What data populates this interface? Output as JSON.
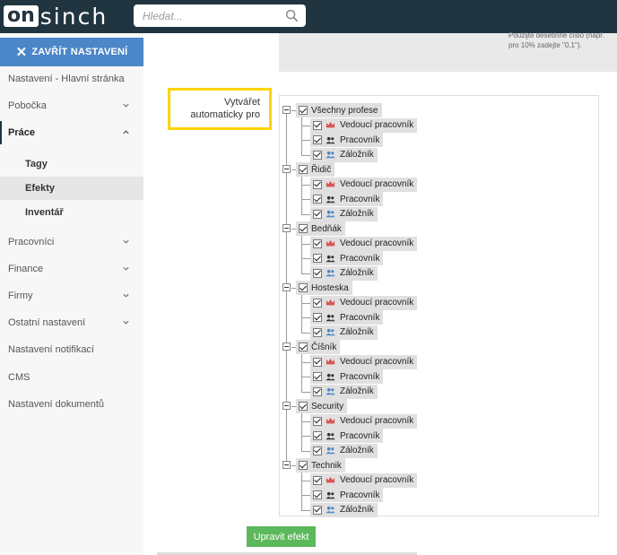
{
  "header": {
    "logo_on": "on",
    "logo_rest": "sinch",
    "search_placeholder": "Hledat..."
  },
  "sidebar": {
    "close_button": "ZAVŘÍT NASTAVENÍ",
    "items": [
      {
        "label": "Nastavení - Hlavní stránka"
      },
      {
        "label": "Pobočka"
      },
      {
        "label": "Práce"
      },
      {
        "label": "Tagy"
      },
      {
        "label": "Efekty"
      },
      {
        "label": "Inventář"
      },
      {
        "label": "Pracovníci"
      },
      {
        "label": "Finance"
      },
      {
        "label": "Firmy"
      },
      {
        "label": "Ostatní nastavení"
      },
      {
        "label": "Nastavení notifikací"
      },
      {
        "label": "CMS"
      },
      {
        "label": "Nastavení dokumentů"
      }
    ]
  },
  "main": {
    "hint_text": "Použijte desetinné číslo (např. pro 10% zadejte \"0,1\").",
    "auto_label": "Vytvářet automaticky pro",
    "submit_button": "Upravit efekt"
  },
  "tree": [
    {
      "label": "Všechny profese",
      "children": [
        {
          "label": "Vedoucí pracovník",
          "icon": "crown-icon"
        },
        {
          "label": "Pracovník",
          "icon": "users-icon"
        },
        {
          "label": "Záložník",
          "icon": "users-blue-icon"
        }
      ]
    },
    {
      "label": "Řidič",
      "children": [
        {
          "label": "Vedoucí pracovník",
          "icon": "crown-icon"
        },
        {
          "label": "Pracovník",
          "icon": "users-icon"
        },
        {
          "label": "Záložník",
          "icon": "users-blue-icon"
        }
      ]
    },
    {
      "label": "Bedňák",
      "children": [
        {
          "label": "Vedoucí pracovník",
          "icon": "crown-icon"
        },
        {
          "label": "Pracovník",
          "icon": "users-icon"
        },
        {
          "label": "Záložník",
          "icon": "users-blue-icon"
        }
      ]
    },
    {
      "label": "Hosteska",
      "children": [
        {
          "label": "Vedoucí pracovník",
          "icon": "crown-icon"
        },
        {
          "label": "Pracovník",
          "icon": "users-icon"
        },
        {
          "label": "Záložník",
          "icon": "users-blue-icon"
        }
      ]
    },
    {
      "label": "Číšník",
      "children": [
        {
          "label": "Vedoucí pracovník",
          "icon": "crown-icon"
        },
        {
          "label": "Pracovník",
          "icon": "users-icon"
        },
        {
          "label": "Záložník",
          "icon": "users-blue-icon"
        }
      ]
    },
    {
      "label": "Security",
      "children": [
        {
          "label": "Vedoucí pracovník",
          "icon": "crown-icon"
        },
        {
          "label": "Pracovník",
          "icon": "users-icon"
        },
        {
          "label": "Záložník",
          "icon": "users-blue-icon"
        }
      ]
    },
    {
      "label": "Technik",
      "children": [
        {
          "label": "Vedoucí pracovník",
          "icon": "crown-icon"
        },
        {
          "label": "Pracovník",
          "icon": "users-icon"
        },
        {
          "label": "Záložník",
          "icon": "users-blue-icon"
        }
      ]
    }
  ],
  "colors": {
    "header_bg": "#213540",
    "close_button_bg": "#4a86c8",
    "highlight_border": "#ffd400",
    "submit_bg": "#5cb85c",
    "crown": "#d9534f",
    "backup_icon": "#4a86c8"
  }
}
